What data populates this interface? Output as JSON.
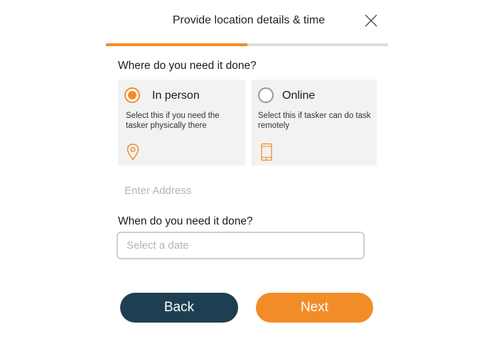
{
  "header": {
    "title": "Provide location details & time",
    "progress_percent": 50
  },
  "location": {
    "question": "Where do you need it done?",
    "options": [
      {
        "label": "In person",
        "description": "Select this if you need the tasker physically there",
        "selected": true,
        "icon": "location-pin-icon"
      },
      {
        "label": "Online",
        "description": "Select this if tasker can do task remotely",
        "selected": false,
        "icon": "mobile-phone-icon"
      }
    ],
    "address_placeholder": "Enter Address"
  },
  "time": {
    "question": "When do you need it done?",
    "date_placeholder": "Select a date"
  },
  "buttons": {
    "back_label": "Back",
    "next_label": "Next"
  },
  "colors": {
    "accent": "#f28c28",
    "dark_button": "#1e3f52",
    "option_background": "#f2f2f2"
  }
}
